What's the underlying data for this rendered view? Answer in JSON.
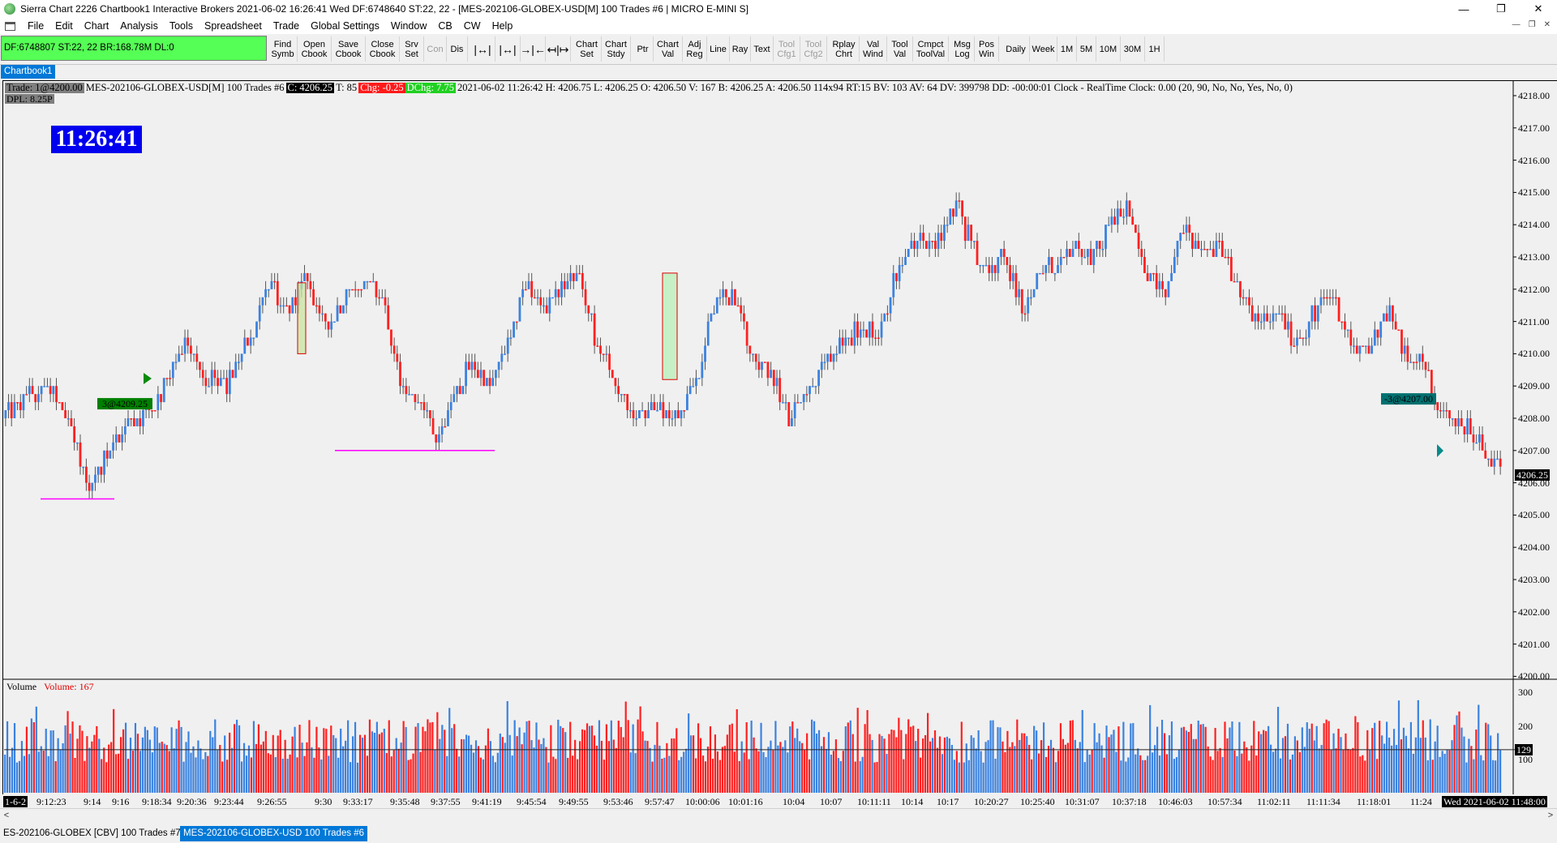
{
  "window": {
    "title": "Sierra Chart 2226 Chartbook1  Interactive Brokers 2021-06-02  16:26:41 Wed  DF:6748640  ST:22, 22  - [MES-202106-GLOBEX-USD[M]  100 Trades  #6 | MICRO E-MINI S]",
    "minimize": "—",
    "maximize": "❐",
    "close": "✕"
  },
  "menu": [
    "File",
    "Edit",
    "Chart",
    "Analysis",
    "Tools",
    "Spreadsheet",
    "Trade",
    "Global Settings",
    "Window",
    "CB",
    "CW",
    "Help"
  ],
  "mdi_controls": [
    "—",
    "❐",
    "✕"
  ],
  "status_box": "DF:6748807  ST:22, 22  BR:168.78M  DL:0",
  "toolbar": [
    {
      "id": "find-symbol",
      "l1": "Find",
      "l2": "Symb",
      "x": 331,
      "w": 36
    },
    {
      "id": "open-cbook",
      "l1": "Open",
      "l2": "Cbook",
      "x": 367,
      "w": 42
    },
    {
      "id": "save-cbook",
      "l1": "Save",
      "l2": "Cbook",
      "x": 409,
      "w": 42
    },
    {
      "id": "close-cbook",
      "l1": "Close",
      "l2": "Cbook",
      "x": 451,
      "w": 42
    },
    {
      "id": "srv-set",
      "l1": "Srv",
      "l2": "Set",
      "x": 493,
      "w": 30
    },
    {
      "id": "con",
      "l1": "Con",
      "l2": "",
      "x": 523,
      "w": 28,
      "dis": true
    },
    {
      "id": "dis",
      "l1": "Dis",
      "l2": "",
      "x": 551,
      "w": 26
    },
    {
      "id": "zoom-fit",
      "l1": "|↔|",
      "l2": "",
      "x": 580,
      "w": 31,
      "ico": true
    },
    {
      "id": "zoom-in",
      "l1": "|↔|",
      "l2": "",
      "x": 611,
      "w": 31,
      "ico": true
    },
    {
      "id": "zoom-out",
      "l1": "→|←",
      "l2": "",
      "x": 642,
      "w": 31,
      "ico": true
    },
    {
      "id": "scroll-split",
      "l1": "↤|↦",
      "l2": "",
      "x": 673,
      "w": 31,
      "ico": true
    },
    {
      "id": "chart-set",
      "l1": "Chart",
      "l2": "Set",
      "x": 706,
      "w": 36
    },
    {
      "id": "chart-stdy",
      "l1": "Chart",
      "l2": "Stdy",
      "x": 742,
      "w": 36
    },
    {
      "id": "ptr",
      "l1": "Ptr",
      "l2": "",
      "x": 780,
      "w": 26
    },
    {
      "id": "chart-val",
      "l1": "Chart",
      "l2": "Val",
      "x": 806,
      "w": 36
    },
    {
      "id": "adj-reg",
      "l1": "Adj",
      "l2": "Reg",
      "x": 842,
      "w": 30
    },
    {
      "id": "line",
      "l1": "Line",
      "l2": "",
      "x": 872,
      "w": 28
    },
    {
      "id": "ray",
      "l1": "Ray",
      "l2": "",
      "x": 900,
      "w": 26
    },
    {
      "id": "text",
      "l1": "Text",
      "l2": "",
      "x": 926,
      "w": 28
    },
    {
      "id": "tool-cfg1",
      "l1": "Tool",
      "l2": "Cfg1",
      "x": 954,
      "w": 33,
      "dis": true
    },
    {
      "id": "tool-cfg2",
      "l1": "Tool",
      "l2": "Cfg2",
      "x": 987,
      "w": 33,
      "dis": true
    },
    {
      "id": "rplay-chrt",
      "l1": "Rplay",
      "l2": "Chrt",
      "x": 1022,
      "w": 38
    },
    {
      "id": "val-wind",
      "l1": "Val",
      "l2": "Wind",
      "x": 1060,
      "w": 34
    },
    {
      "id": "tool-val",
      "l1": "Tool",
      "l2": "Val",
      "x": 1094,
      "w": 32
    },
    {
      "id": "cmpct-toolval",
      "l1": "Cmpct",
      "l2": "ToolVal",
      "x": 1126,
      "w": 44
    },
    {
      "id": "msg-log",
      "l1": "Msg",
      "l2": "Log",
      "x": 1172,
      "w": 30
    },
    {
      "id": "pos-win",
      "l1": "Pos",
      "l2": "Win",
      "x": 1202,
      "w": 30
    },
    {
      "id": "daily",
      "l1": "Daily",
      "l2": "",
      "x": 1236,
      "w": 34
    },
    {
      "id": "week",
      "l1": "Week",
      "l2": "",
      "x": 1270,
      "w": 34
    },
    {
      "id": "1m",
      "l1": "1M",
      "l2": "",
      "x": 1304,
      "w": 24
    },
    {
      "id": "5m",
      "l1": "5M",
      "l2": "",
      "x": 1328,
      "w": 24
    },
    {
      "id": "10m",
      "l1": "10M",
      "l2": "",
      "x": 1352,
      "w": 30
    },
    {
      "id": "30m",
      "l1": "30M",
      "l2": "",
      "x": 1382,
      "w": 30
    },
    {
      "id": "1h",
      "l1": "1H",
      "l2": "",
      "x": 1412,
      "w": 24
    }
  ],
  "chartbook_tab": "Chartbook1",
  "header": {
    "trade": "Trade: 1@4200.00",
    "symbol": "MES-202106-GLOBEX-USD[M]  100 Trades  #6",
    "close": "C: 4206.25",
    "t": "T: 85",
    "chg": "Chg: -0.25",
    "dchg": "DChg: 7.75",
    "rest": "2021-06-02 11:26:42 H: 4206.75 L: 4206.25 O: 4206.50 V: 167 B: 4206.25 A: 4206.50 114x94 RT:15 BV: 103 AV: 64 DV: 399798 DD: -00:00:01 Clock - RealTime  Clock: 0.00   (20, 90, No, No, Yes, No, 0)",
    "dpl": "DPL: 8.25P"
  },
  "clock": "11:26:41",
  "chart_data": {
    "type": "candlestick",
    "title": "",
    "ylim": [
      4200,
      4218
    ],
    "price_ticks": [
      "4218.00",
      "4217.00",
      "4216.00",
      "4215.00",
      "4214.00",
      "4213.00",
      "4212.00",
      "4211.00",
      "4210.00",
      "4209.00",
      "4208.00",
      "4207.00",
      "4206.00",
      "4205.00",
      "4204.00",
      "4203.00",
      "4202.00",
      "4201.00",
      "4200.00"
    ],
    "last_price": "4206.25",
    "path_anchors": [
      [
        0,
        4208.1
      ],
      [
        5,
        4208.3
      ],
      [
        9,
        4208.8
      ],
      [
        16,
        4208.9
      ],
      [
        22,
        4207.6
      ],
      [
        28,
        4205.9
      ],
      [
        36,
        4207.2
      ],
      [
        42,
        4207.9
      ],
      [
        46,
        4208.1
      ],
      [
        52,
        4208.7
      ],
      [
        60,
        4210.4
      ],
      [
        66,
        4209.4
      ],
      [
        74,
        4209.0
      ],
      [
        82,
        4210.6
      ],
      [
        88,
        4212.2
      ],
      [
        94,
        4211.3
      ],
      [
        100,
        4212.3
      ],
      [
        104,
        4211.6
      ],
      [
        108,
        4210.9
      ],
      [
        114,
        4211.8
      ],
      [
        120,
        4212.2
      ],
      [
        126,
        4211.6
      ],
      [
        132,
        4209.0
      ],
      [
        138,
        4208.7
      ],
      [
        144,
        4207.4
      ],
      [
        150,
        4208.7
      ],
      [
        156,
        4209.7
      ],
      [
        162,
        4208.9
      ],
      [
        168,
        4210.5
      ],
      [
        174,
        4212.1
      ],
      [
        180,
        4211.6
      ],
      [
        186,
        4211.9
      ],
      [
        192,
        4212.4
      ],
      [
        198,
        4210.2
      ],
      [
        204,
        4209.2
      ],
      [
        210,
        4207.9
      ],
      [
        216,
        4208.4
      ],
      [
        224,
        4208.1
      ],
      [
        232,
        4209.4
      ],
      [
        238,
        4212.0
      ],
      [
        244,
        4211.7
      ],
      [
        250,
        4209.8
      ],
      [
        256,
        4209.3
      ],
      [
        262,
        4208.0
      ],
      [
        270,
        4209.3
      ],
      [
        278,
        4210.1
      ],
      [
        286,
        4210.9
      ],
      [
        292,
        4210.4
      ],
      [
        298,
        4212.5
      ],
      [
        304,
        4213.4
      ],
      [
        312,
        4213.6
      ],
      [
        318,
        4214.7
      ],
      [
        322,
        4213.6
      ],
      [
        328,
        4212.4
      ],
      [
        334,
        4213.1
      ],
      [
        340,
        4211.3
      ],
      [
        346,
        4212.5
      ],
      [
        352,
        4212.9
      ],
      [
        358,
        4213.3
      ],
      [
        364,
        4212.9
      ],
      [
        370,
        4214.1
      ],
      [
        376,
        4214.5
      ],
      [
        382,
        4212.5
      ],
      [
        388,
        4212.0
      ],
      [
        394,
        4213.9
      ],
      [
        400,
        4212.9
      ],
      [
        406,
        4213.5
      ],
      [
        412,
        4212.1
      ],
      [
        418,
        4211.0
      ],
      [
        426,
        4211.2
      ],
      [
        432,
        4210.2
      ],
      [
        438,
        4211.3
      ],
      [
        444,
        4211.9
      ],
      [
        450,
        4210.4
      ],
      [
        456,
        4210.1
      ],
      [
        462,
        4211.3
      ],
      [
        468,
        4210.1
      ],
      [
        474,
        4209.8
      ],
      [
        480,
        4208.2
      ],
      [
        486,
        4207.8
      ],
      [
        492,
        4207.4
      ],
      [
        500,
        4206.4
      ]
    ],
    "hlines": [
      {
        "x1": 50,
        "x2": 141,
        "price": 4205.5
      },
      {
        "x1": 413,
        "x2": 610,
        "price": 4207.0
      }
    ],
    "highlight_boxes": [
      {
        "x1": 367,
        "x2": 377,
        "top": 4212.2,
        "bottom": 4210.0,
        "fill": "#c8e6a0"
      },
      {
        "x1": 817,
        "x2": 835,
        "top": 4212.5,
        "bottom": 4209.2,
        "fill": "#b8f0b8"
      }
    ],
    "trade_markers": [
      {
        "label": "3@4209.25",
        "x": 120,
        "price": 4208.45,
        "bg": "#008000"
      },
      {
        "label": "-3@4207.00",
        "x": 1703,
        "price": 4208.6,
        "bg": "#007070"
      }
    ],
    "volume": {
      "label": "Volume",
      "value_label": "Volume: 167",
      "ticks": [
        "300",
        "200",
        "100"
      ],
      "level_label": "129",
      "level": 129,
      "max": 330
    }
  },
  "time_axis": [
    "1-6-2",
    "9:12:23",
    "9:14",
    "9:16",
    "9:18:34",
    "9:20:36",
    "9:23:44",
    "9:26:55",
    "9:30",
    "9:33:17",
    "9:35:48",
    "9:37:55",
    "9:41:19",
    "9:45:54",
    "9:49:55",
    "9:53:46",
    "9:57:47",
    "10:00:06",
    "10:01:16",
    "10:04",
    "10:07",
    "10:11:11",
    "10:14",
    "10:17",
    "10:20:27",
    "10:25:40",
    "10:31:07",
    "10:37:18",
    "10:46:03",
    "10:57:34",
    "11:02:11",
    "11:11:34",
    "11:18:01",
    "11:24",
    "Wed 2021-06-02  11:48:00"
  ],
  "time_axis_x": [
    3,
    42,
    100,
    135,
    172,
    215,
    261,
    314,
    385,
    420,
    478,
    528,
    579,
    634,
    686,
    741,
    792,
    842,
    895,
    962,
    1008,
    1054,
    1108,
    1152,
    1198,
    1255,
    1310,
    1368,
    1425,
    1486,
    1547,
    1608,
    1670,
    1736,
    1775
  ],
  "bottom_tabs": [
    "ES-202106-GLOBEX [CBV]  100 Trades  #7",
    "MES-202106-GLOBEX-USD  100 Trades  #6"
  ],
  "colors": {
    "up": "#3b82e0",
    "down": "#ff2020",
    "grid": "#d9d9d9",
    "hline": "#ff00ff"
  }
}
